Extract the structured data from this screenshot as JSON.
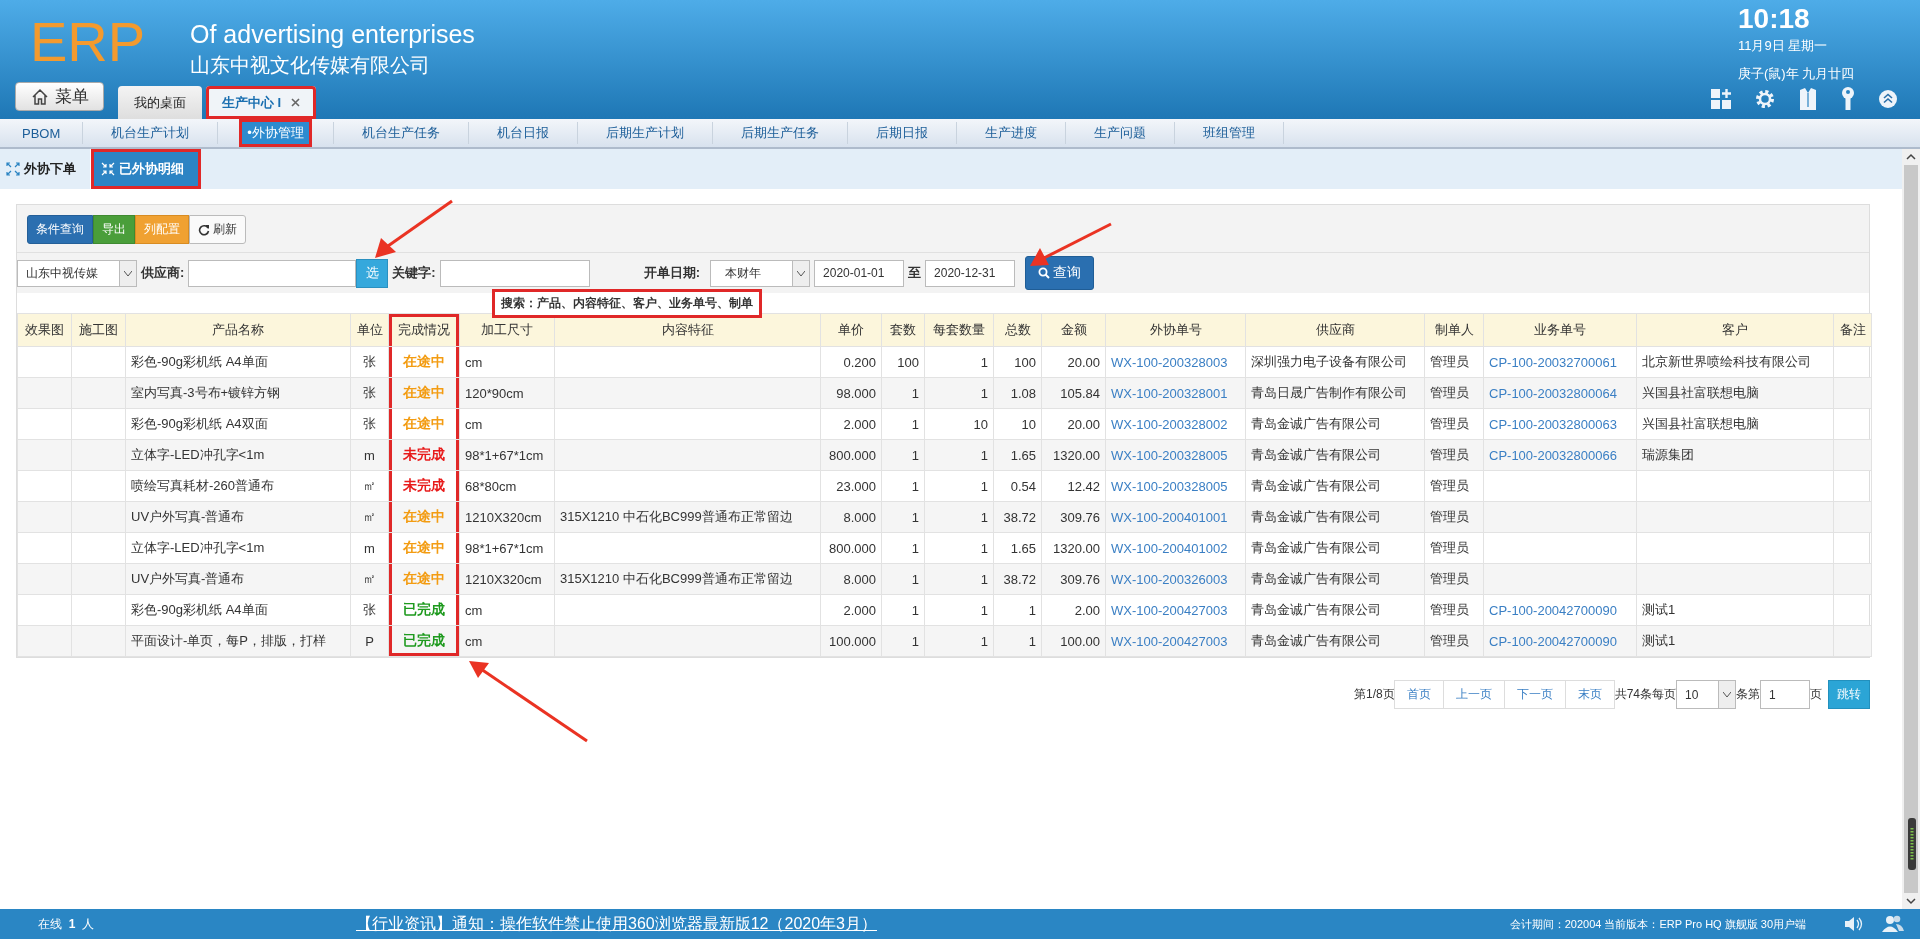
{
  "header": {
    "logo": "ERP",
    "title": "Of advertising enterprises",
    "company": "山东中视文化传媒有限公司",
    "time": "10:18",
    "date": "11月9日 星期一",
    "lunar_date": "庚子(鼠)年 九月廿四",
    "menu_button": "菜单"
  },
  "tabs": [
    {
      "label": "我的桌面",
      "selected": false,
      "closable": false,
      "highlighted": false
    },
    {
      "label": "生产中心 I",
      "selected": true,
      "closable": true,
      "highlighted": true
    }
  ],
  "nav": [
    {
      "label": "PBOM",
      "selected": false
    },
    {
      "label": "机台生产计划",
      "selected": false
    },
    {
      "label": "•外协管理",
      "selected": true
    },
    {
      "label": "机台生产任务",
      "selected": false
    },
    {
      "label": "机台日报",
      "selected": false
    },
    {
      "label": "后期生产计划",
      "selected": false
    },
    {
      "label": "后期生产任务",
      "selected": false
    },
    {
      "label": "后期日报",
      "selected": false
    },
    {
      "label": "生产进度",
      "selected": false
    },
    {
      "label": "生产问题",
      "selected": false
    },
    {
      "label": "班组管理",
      "selected": false
    }
  ],
  "subtabs": [
    {
      "label": "外协下单",
      "selected": false
    },
    {
      "label": "已外协明细",
      "selected": true
    }
  ],
  "toolbar": [
    {
      "label": "条件查询",
      "kind": "primary"
    },
    {
      "label": "导出",
      "kind": "success"
    },
    {
      "label": "列配置",
      "kind": "warning"
    },
    {
      "label": "刷新",
      "kind": "refresh"
    }
  ],
  "filters": {
    "company": "山东中视传媒",
    "supplier_label": "供应商:",
    "pick_button": "选",
    "keyword_label": "关键字:",
    "tooltip": "搜索：产品、内容特征、客户、业务单号、制单",
    "date_label": "开单日期:",
    "period": "本财年",
    "date_from": "2020-01-01",
    "to_label": "至",
    "date_to": "2020-12-31",
    "search_button": "查询"
  },
  "table": {
    "columns": [
      {
        "label": "效果图",
        "kind": "text",
        "highlighted": false
      },
      {
        "label": "施工图",
        "kind": "text",
        "highlighted": false
      },
      {
        "label": "产品名称",
        "kind": "text",
        "highlighted": false
      },
      {
        "label": "单位",
        "kind": "center",
        "highlighted": false
      },
      {
        "label": "完成情况",
        "kind": "status",
        "highlighted": true
      },
      {
        "label": "加工尺寸",
        "kind": "text",
        "highlighted": false
      },
      {
        "label": "内容特征",
        "kind": "text",
        "highlighted": false
      },
      {
        "label": "单价",
        "kind": "number",
        "highlighted": false
      },
      {
        "label": "套数",
        "kind": "number",
        "highlighted": false
      },
      {
        "label": "每套数量",
        "kind": "number",
        "highlighted": false
      },
      {
        "label": "总数",
        "kind": "number",
        "highlighted": false
      },
      {
        "label": "金额",
        "kind": "number",
        "highlighted": false
      },
      {
        "label": "外协单号",
        "kind": "link",
        "highlighted": false
      },
      {
        "label": "供应商",
        "kind": "text",
        "highlighted": false
      },
      {
        "label": "制单人",
        "kind": "text",
        "highlighted": false
      },
      {
        "label": "业务单号",
        "kind": "link",
        "highlighted": false
      },
      {
        "label": "客户",
        "kind": "text",
        "highlighted": false
      },
      {
        "label": "备注",
        "kind": "text",
        "highlighted": false
      }
    ],
    "rows": [
      {
        "cells": [
          null,
          null,
          "彩色-90g彩机纸 A4单面",
          "张",
          {
            "text": "在途中",
            "color": "#f39c12"
          },
          "cm",
          null,
          "0.200",
          "100",
          "1",
          "100",
          "20.00",
          "WX-100-200328003",
          "深圳强力电子设备有限公司",
          "管理员",
          "CP-100-20032700061",
          "北京新世界喷绘科技有限公司",
          null
        ]
      },
      {
        "cells": [
          null,
          null,
          "室内写真-3号布+镀锌方钢",
          "张",
          {
            "text": "在途中",
            "color": "#f39c12"
          },
          "120*90cm",
          null,
          "98.000",
          "1",
          "1",
          "1.08",
          "105.84",
          "WX-100-200328001",
          "青岛日晟广告制作有限公司",
          "管理员",
          "CP-100-20032800064",
          "兴国县社富联想电脑",
          null
        ]
      },
      {
        "cells": [
          null,
          null,
          "彩色-90g彩机纸 A4双面",
          "张",
          {
            "text": "在途中",
            "color": "#f39c12"
          },
          "cm",
          null,
          "2.000",
          "1",
          "10",
          "10",
          "20.00",
          "WX-100-200328002",
          "青岛金诚广告有限公司",
          "管理员",
          "CP-100-20032800063",
          "兴国县社富联想电脑",
          null
        ]
      },
      {
        "cells": [
          null,
          null,
          "立体字-LED冲孔字<1m",
          "m",
          {
            "text": "未完成",
            "color": "#e81b1b"
          },
          "98*1+67*1cm",
          null,
          "800.000",
          "1",
          "1",
          "1.65",
          "1320.00",
          "WX-100-200328005",
          "青岛金诚广告有限公司",
          "管理员",
          "CP-100-20032800066",
          "瑞源集团",
          null
        ]
      },
      {
        "cells": [
          null,
          null,
          "喷绘写真耗材-260普通布",
          "㎡",
          {
            "text": "未完成",
            "color": "#e81b1b"
          },
          "68*80cm",
          null,
          "23.000",
          "1",
          "1",
          "0.54",
          "12.42",
          "WX-100-200328005",
          "青岛金诚广告有限公司",
          "管理员",
          null,
          null,
          null
        ]
      },
      {
        "cells": [
          null,
          null,
          "UV户外写真-普通布",
          "㎡",
          {
            "text": "在途中",
            "color": "#f39c12"
          },
          "1210X320cm",
          "315X1210 中石化BC999普通布正常留边",
          "8.000",
          "1",
          "1",
          "38.72",
          "309.76",
          "WX-100-200401001",
          "青岛金诚广告有限公司",
          "管理员",
          null,
          null,
          null
        ]
      },
      {
        "cells": [
          null,
          null,
          "立体字-LED冲孔字<1m",
          "m",
          {
            "text": "在途中",
            "color": "#f39c12"
          },
          "98*1+67*1cm",
          null,
          "800.000",
          "1",
          "1",
          "1.65",
          "1320.00",
          "WX-100-200401002",
          "青岛金诚广告有限公司",
          "管理员",
          null,
          null,
          null
        ]
      },
      {
        "cells": [
          null,
          null,
          "UV户外写真-普通布",
          "㎡",
          {
            "text": "在途中",
            "color": "#f39c12"
          },
          "1210X320cm",
          "315X1210 中石化BC999普通布正常留边",
          "8.000",
          "1",
          "1",
          "38.72",
          "309.76",
          "WX-100-200326003",
          "青岛金诚广告有限公司",
          "管理员",
          null,
          null,
          null
        ]
      },
      {
        "cells": [
          null,
          null,
          "彩色-90g彩机纸 A4单面",
          "张",
          {
            "text": "已完成",
            "color": "#1e9a1e"
          },
          "cm",
          null,
          "2.000",
          "1",
          "1",
          "1",
          "2.00",
          "WX-100-200427003",
          "青岛金诚广告有限公司",
          "管理员",
          "CP-100-20042700090",
          "测试1",
          null
        ]
      },
      {
        "cells": [
          null,
          null,
          "平面设计-单页，每P，排版，打样",
          "P",
          {
            "text": "已完成",
            "color": "#1e9a1e"
          },
          "cm",
          null,
          "100.000",
          "1",
          "1",
          "1",
          "100.00",
          "WX-100-200427003",
          "青岛金诚广告有限公司",
          "管理员",
          "CP-100-20042700090",
          "测试1",
          null
        ]
      }
    ]
  },
  "pagination": {
    "page_info": "第1/8页",
    "buttons": [
      "首页",
      "上一页",
      "下一页",
      "末页"
    ],
    "total_text": "共74条每页",
    "page_size": "10",
    "goto_label": "条第",
    "page_input": "1",
    "page_suffix": "页",
    "go_button": "跳转"
  },
  "status_bar": {
    "online_label": "在线",
    "online_count": "1",
    "online_unit": "人",
    "news": "【行业资讯】通知：操作软件禁止使用360浏览器最新版12（2020年3月）",
    "version": "会计期间：202004 当前版本：ERP Pro HQ 旗舰版 30用户端"
  }
}
